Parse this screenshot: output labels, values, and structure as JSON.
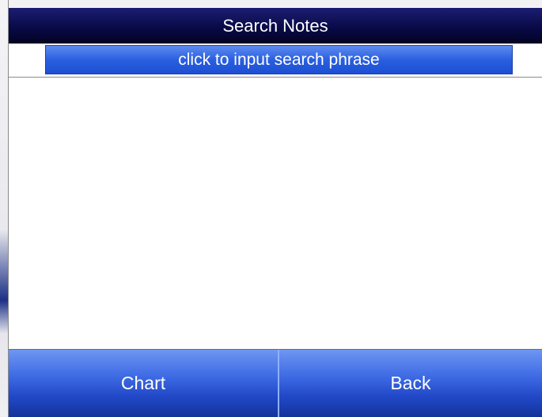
{
  "window": {
    "title": "Search Notes"
  },
  "search": {
    "placeholder": "click to input search phrase"
  },
  "notes": {
    "items": []
  },
  "buttons": {
    "chart_label": "Chart",
    "back_label": "Back"
  },
  "colors": {
    "title_bar": "#090a48",
    "search_field": "#2a5fe0",
    "button": "#2148c7",
    "text": "#ffffff"
  }
}
